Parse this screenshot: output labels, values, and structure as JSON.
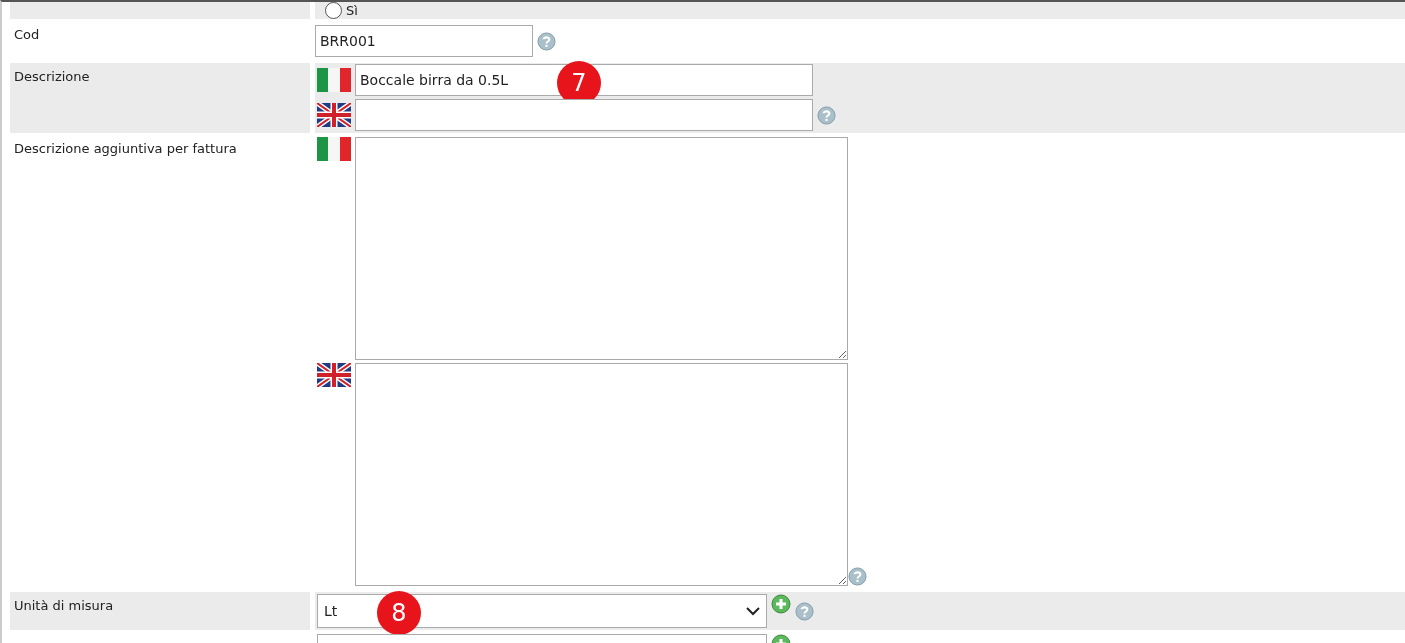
{
  "top_option": {
    "label": "Sì",
    "selected": false
  },
  "fields": [
    {
      "kind": "text",
      "label": "Cod",
      "value": "BRR001",
      "help": true
    },
    {
      "kind": "multilang",
      "label": "Descrizione",
      "entries": [
        {
          "kind": "it",
          "value": "Boccale birra da 0.5L",
          "marker": "7"
        },
        {
          "kind": "en"
        }
      ],
      "help": true
    },
    {
      "kind": "multitextarea",
      "label": "Descrizione aggiuntiva per fattura",
      "entries": [
        {
          "kind": "it"
        },
        {
          "kind": "en"
        }
      ],
      "help": true
    },
    {
      "kind": "select",
      "label": "Unità di misura",
      "value": "Lt",
      "marker": "8",
      "add": true,
      "help": true
    },
    {
      "kind": "select",
      "add": true
    }
  ]
}
